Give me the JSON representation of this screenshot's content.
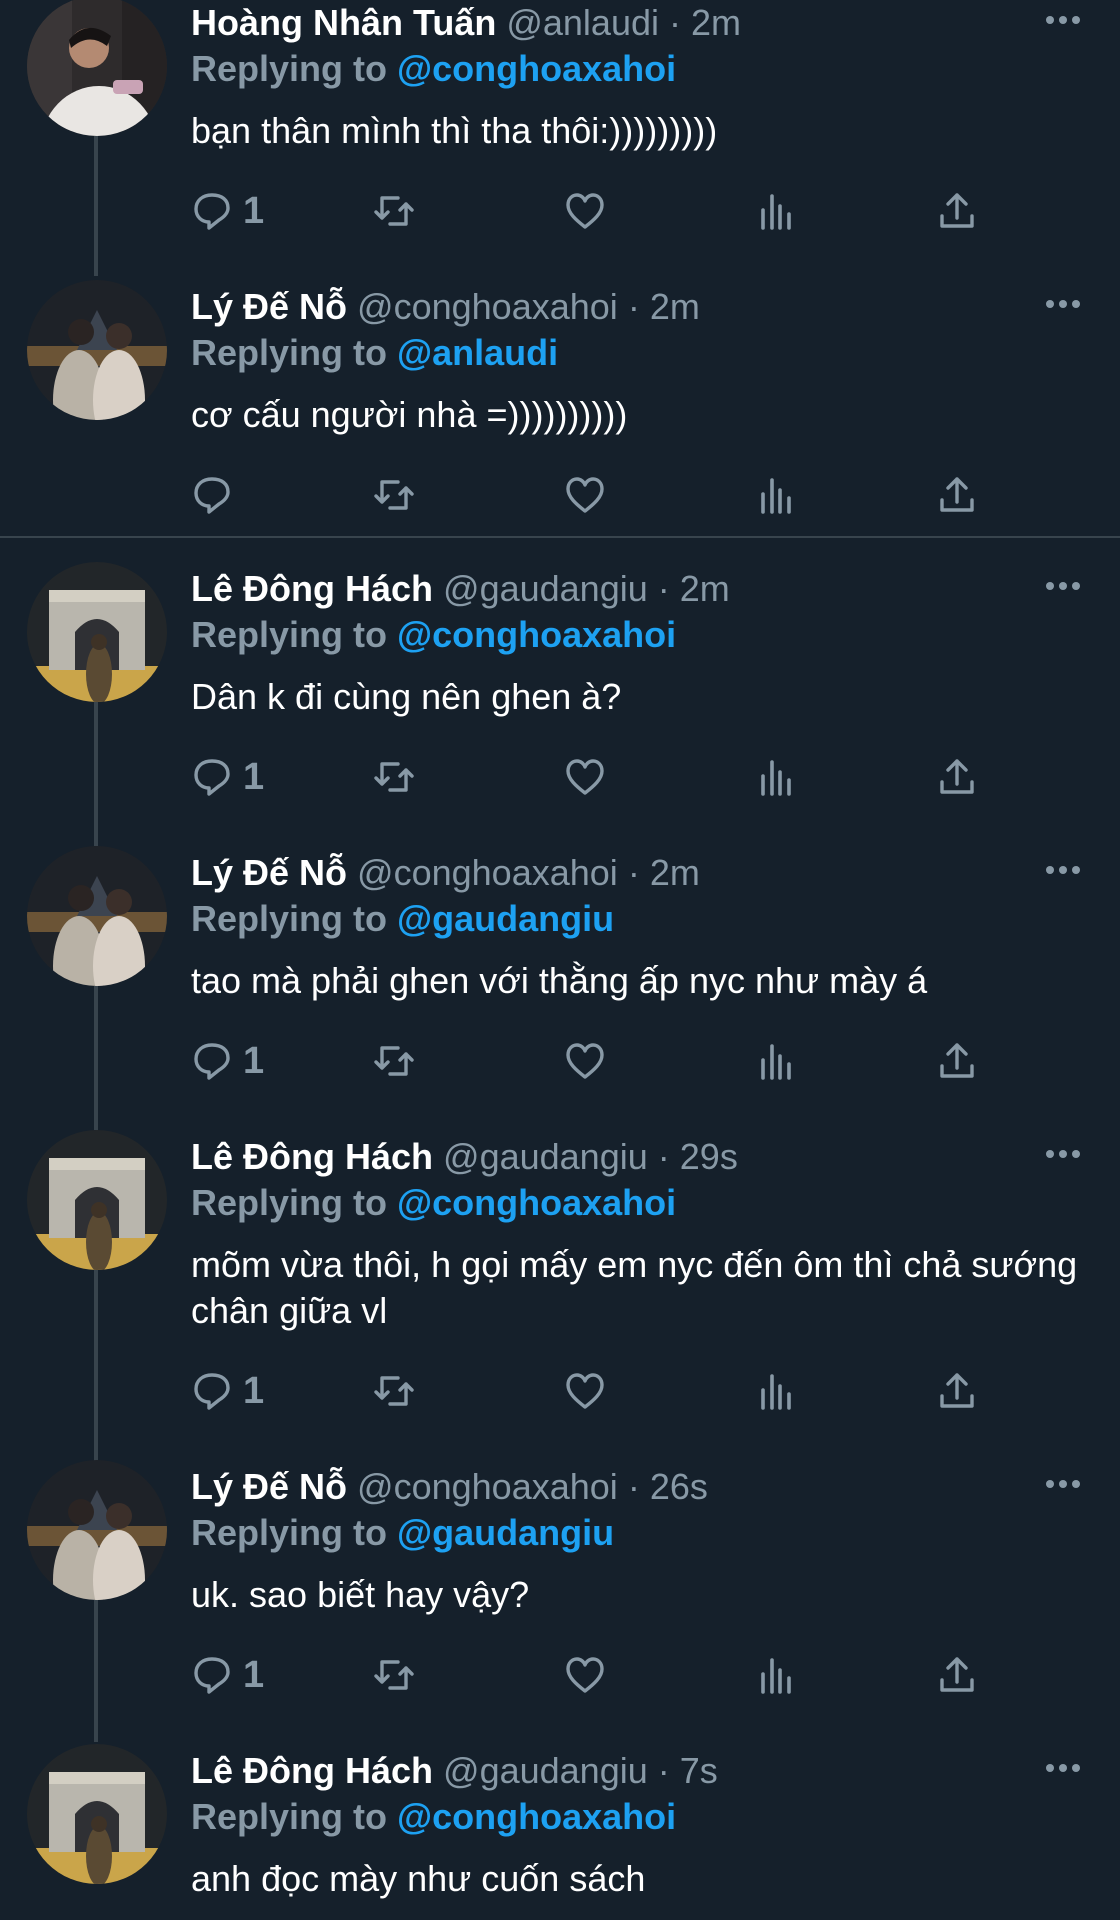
{
  "colors": {
    "background": "#15202b",
    "muted": "#8899a6",
    "link": "#1da1f2",
    "thread_line": "#38444d"
  },
  "tweets": [
    {
      "name": "Hoàng Nhân Tuấn",
      "handle": "@anlaudi",
      "sep": "·",
      "time": "2m",
      "replying_label": "Replying to",
      "replying_to": "@conghoaxahoi",
      "text": "bạn thân mình thì tha thôi:)))))))))",
      "reply_count": "1",
      "avatar": "user-photo-white-shirt"
    },
    {
      "name": "Lý Đế Nỗ",
      "handle": "@conghoaxahoi",
      "sep": "·",
      "time": "2m",
      "replying_label": "Replying to",
      "replying_to": "@anlaudi",
      "text": "cơ cấu người nhà =))))))))))",
      "reply_count": "",
      "avatar": "couple-photo-night"
    },
    {
      "name": "Lê Đông Hách",
      "handle": "@gaudangiu",
      "sep": "·",
      "time": "2m",
      "replying_label": "Replying to",
      "replying_to": "@conghoaxahoi",
      "text": "Dân k đi cùng nên ghen à?",
      "reply_count": "1",
      "avatar": "arc-de-triomphe-photo"
    },
    {
      "name": "Lý Đế Nỗ",
      "handle": "@conghoaxahoi",
      "sep": "·",
      "time": "2m",
      "replying_label": "Replying to",
      "replying_to": "@gaudangiu",
      "text": "tao mà phải ghen với thằng ấp nyc như mày á",
      "reply_count": "1",
      "avatar": "couple-photo-night"
    },
    {
      "name": "Lê Đông Hách",
      "handle": "@gaudangiu",
      "sep": "·",
      "time": "29s",
      "replying_label": "Replying to",
      "replying_to": "@conghoaxahoi",
      "text": "mõm vừa thôi, h gọi mấy em nyc đến ôm thì chả sướng chân giữa vl",
      "reply_count": "1",
      "avatar": "arc-de-triomphe-photo"
    },
    {
      "name": "Lý Đế Nỗ",
      "handle": "@conghoaxahoi",
      "sep": "·",
      "time": "26s",
      "replying_label": "Replying to",
      "replying_to": "@gaudangiu",
      "text": "uk. sao biết hay vậy?",
      "reply_count": "1",
      "avatar": "couple-photo-night"
    },
    {
      "name": "Lê Đông Hách",
      "handle": "@gaudangiu",
      "sep": "·",
      "time": "7s",
      "replying_label": "Replying to",
      "replying_to": "@conghoaxahoi",
      "text": "anh đọc mày như cuốn sách",
      "reply_count": "",
      "avatar": "arc-de-triomphe-photo"
    }
  ],
  "icons": [
    "reply-icon",
    "retweet-icon",
    "like-icon",
    "analytics-icon",
    "share-icon",
    "more-icon"
  ]
}
